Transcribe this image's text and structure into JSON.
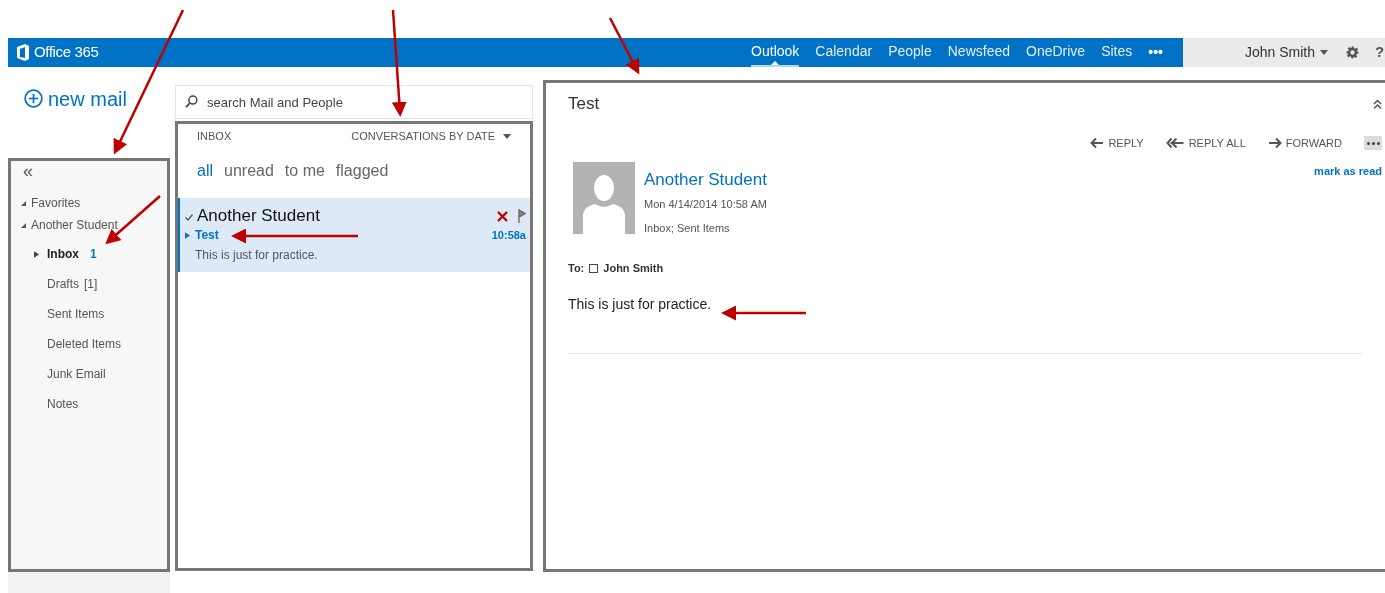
{
  "top_bar": {
    "brand": "Office 365",
    "nav": [
      {
        "label": "Outlook",
        "selected": true
      },
      {
        "label": "Calendar",
        "selected": false
      },
      {
        "label": "People",
        "selected": false
      },
      {
        "label": "Newsfeed",
        "selected": false
      },
      {
        "label": "OneDrive",
        "selected": false
      },
      {
        "label": "Sites",
        "selected": false
      }
    ],
    "more": "•••",
    "user": "John Smith",
    "help": "?"
  },
  "new_mail": "new mail",
  "collapse": "«",
  "folders": [
    {
      "label": "Favorites",
      "expanded": true
    },
    {
      "label": "Another Student",
      "expanded": true,
      "children": [
        {
          "label": "Inbox",
          "count": "1",
          "selected": true
        },
        {
          "label": "Drafts",
          "count": "[1]",
          "selected": false
        },
        {
          "label": "Sent Items",
          "selected": false
        },
        {
          "label": "Deleted Items",
          "selected": false
        },
        {
          "label": "Junk Email",
          "selected": false
        },
        {
          "label": "Notes",
          "selected": false
        }
      ]
    }
  ],
  "message_list": {
    "search": {
      "placeholder": "search Mail and People"
    },
    "folder": "INBOX",
    "sort": "CONVERSATIONS BY DATE",
    "filters": [
      {
        "label": "all",
        "selected": true
      },
      {
        "label": "unread",
        "selected": false
      },
      {
        "label": "to me",
        "selected": false
      },
      {
        "label": "flagged",
        "selected": false
      }
    ],
    "messages": [
      {
        "sender": "Another Student",
        "subject": "Test",
        "preview": "This is just for practice.",
        "time": "10:58a",
        "selected": true,
        "unread": true
      }
    ]
  },
  "reading_pane": {
    "subject": "Test",
    "actions": [
      "REPLY",
      "REPLY ALL",
      "FORWARD"
    ],
    "sender": "Another Student",
    "date": "Mon 4/14/2014 10:58 AM",
    "folders": "Inbox; Sent Items",
    "mark_as_read": "mark as read",
    "to_label": "To:",
    "recipient": "John Smith",
    "body": "This is just for practice."
  }
}
